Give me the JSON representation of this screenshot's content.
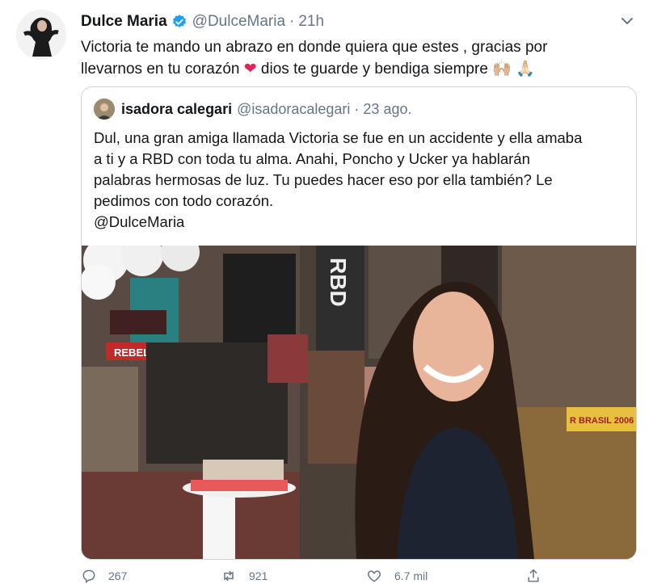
{
  "tweet": {
    "author_name": "Dulce Maria",
    "author_handle": "@DulceMaria",
    "separator": "·",
    "time": "21h",
    "text_line1": "Victoria te mando un abrazo en donde quiera que estes , gracias por",
    "text_line2_a": "llevarnos en tu corazón ",
    "text_heart": "❤",
    "text_line2_b": " dios te guarde y bendiga siempre ",
    "text_emoji": "🙌🏼 🙏🏻",
    "verified_color": "#1da1f2"
  },
  "quoted": {
    "author_name": "isadora calegari",
    "author_handle": "@isadoracalegari",
    "separator": "·",
    "date": "23 ago.",
    "lines": [
      "Dul, una gran amiga llamada Victoria se fue en un accidente y ella amaba",
      "a ti y a RBD con toda tu alma. Anahi, Poncho y Ucker ya hablarán",
      "palabras hermosas de luz. Tu puedes hacer eso por ella también? Le",
      "pedimos con todo corazón.",
      "@DulceMaria"
    ],
    "photo_text": {
      "rbd": "RBD",
      "rebelde": "REBELDE",
      "brasil": "R BRASIL 2006"
    }
  },
  "actions": {
    "reply_count": "267",
    "retweet_count": "921",
    "like_count": "6.7 mil"
  },
  "colors": {
    "link": "#1da1f2",
    "secondary": "#657786",
    "border": "#ccd6dd"
  }
}
